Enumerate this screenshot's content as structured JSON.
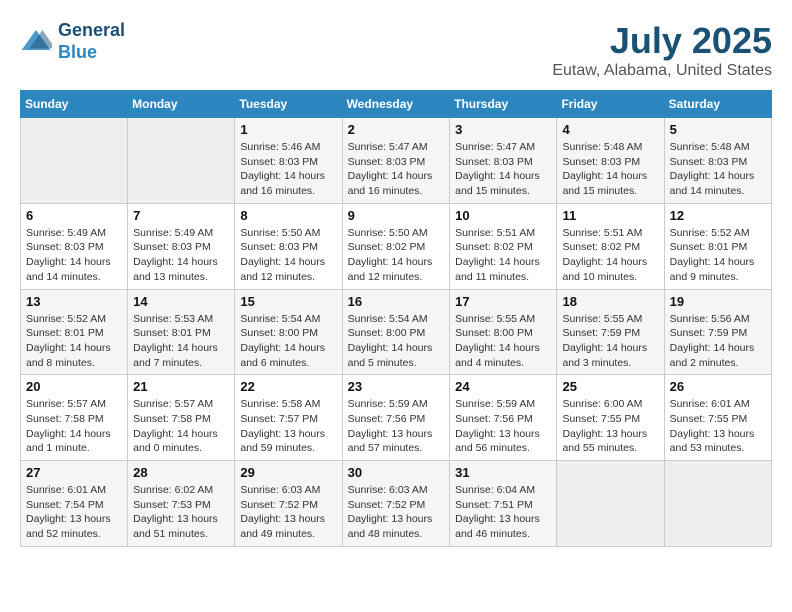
{
  "logo": {
    "line1": "General",
    "line2": "Blue"
  },
  "title": "July 2025",
  "subtitle": "Eutaw, Alabama, United States",
  "days_of_week": [
    "Sunday",
    "Monday",
    "Tuesday",
    "Wednesday",
    "Thursday",
    "Friday",
    "Saturday"
  ],
  "weeks": [
    [
      {
        "day": "",
        "empty": true
      },
      {
        "day": "",
        "empty": true
      },
      {
        "day": "1",
        "sunrise": "Sunrise: 5:46 AM",
        "sunset": "Sunset: 8:03 PM",
        "daylight": "Daylight: 14 hours and 16 minutes."
      },
      {
        "day": "2",
        "sunrise": "Sunrise: 5:47 AM",
        "sunset": "Sunset: 8:03 PM",
        "daylight": "Daylight: 14 hours and 16 minutes."
      },
      {
        "day": "3",
        "sunrise": "Sunrise: 5:47 AM",
        "sunset": "Sunset: 8:03 PM",
        "daylight": "Daylight: 14 hours and 15 minutes."
      },
      {
        "day": "4",
        "sunrise": "Sunrise: 5:48 AM",
        "sunset": "Sunset: 8:03 PM",
        "daylight": "Daylight: 14 hours and 15 minutes."
      },
      {
        "day": "5",
        "sunrise": "Sunrise: 5:48 AM",
        "sunset": "Sunset: 8:03 PM",
        "daylight": "Daylight: 14 hours and 14 minutes."
      }
    ],
    [
      {
        "day": "6",
        "sunrise": "Sunrise: 5:49 AM",
        "sunset": "Sunset: 8:03 PM",
        "daylight": "Daylight: 14 hours and 14 minutes."
      },
      {
        "day": "7",
        "sunrise": "Sunrise: 5:49 AM",
        "sunset": "Sunset: 8:03 PM",
        "daylight": "Daylight: 14 hours and 13 minutes."
      },
      {
        "day": "8",
        "sunrise": "Sunrise: 5:50 AM",
        "sunset": "Sunset: 8:03 PM",
        "daylight": "Daylight: 14 hours and 12 minutes."
      },
      {
        "day": "9",
        "sunrise": "Sunrise: 5:50 AM",
        "sunset": "Sunset: 8:02 PM",
        "daylight": "Daylight: 14 hours and 12 minutes."
      },
      {
        "day": "10",
        "sunrise": "Sunrise: 5:51 AM",
        "sunset": "Sunset: 8:02 PM",
        "daylight": "Daylight: 14 hours and 11 minutes."
      },
      {
        "day": "11",
        "sunrise": "Sunrise: 5:51 AM",
        "sunset": "Sunset: 8:02 PM",
        "daylight": "Daylight: 14 hours and 10 minutes."
      },
      {
        "day": "12",
        "sunrise": "Sunrise: 5:52 AM",
        "sunset": "Sunset: 8:01 PM",
        "daylight": "Daylight: 14 hours and 9 minutes."
      }
    ],
    [
      {
        "day": "13",
        "sunrise": "Sunrise: 5:52 AM",
        "sunset": "Sunset: 8:01 PM",
        "daylight": "Daylight: 14 hours and 8 minutes."
      },
      {
        "day": "14",
        "sunrise": "Sunrise: 5:53 AM",
        "sunset": "Sunset: 8:01 PM",
        "daylight": "Daylight: 14 hours and 7 minutes."
      },
      {
        "day": "15",
        "sunrise": "Sunrise: 5:54 AM",
        "sunset": "Sunset: 8:00 PM",
        "daylight": "Daylight: 14 hours and 6 minutes."
      },
      {
        "day": "16",
        "sunrise": "Sunrise: 5:54 AM",
        "sunset": "Sunset: 8:00 PM",
        "daylight": "Daylight: 14 hours and 5 minutes."
      },
      {
        "day": "17",
        "sunrise": "Sunrise: 5:55 AM",
        "sunset": "Sunset: 8:00 PM",
        "daylight": "Daylight: 14 hours and 4 minutes."
      },
      {
        "day": "18",
        "sunrise": "Sunrise: 5:55 AM",
        "sunset": "Sunset: 7:59 PM",
        "daylight": "Daylight: 14 hours and 3 minutes."
      },
      {
        "day": "19",
        "sunrise": "Sunrise: 5:56 AM",
        "sunset": "Sunset: 7:59 PM",
        "daylight": "Daylight: 14 hours and 2 minutes."
      }
    ],
    [
      {
        "day": "20",
        "sunrise": "Sunrise: 5:57 AM",
        "sunset": "Sunset: 7:58 PM",
        "daylight": "Daylight: 14 hours and 1 minute."
      },
      {
        "day": "21",
        "sunrise": "Sunrise: 5:57 AM",
        "sunset": "Sunset: 7:58 PM",
        "daylight": "Daylight: 14 hours and 0 minutes."
      },
      {
        "day": "22",
        "sunrise": "Sunrise: 5:58 AM",
        "sunset": "Sunset: 7:57 PM",
        "daylight": "Daylight: 13 hours and 59 minutes."
      },
      {
        "day": "23",
        "sunrise": "Sunrise: 5:59 AM",
        "sunset": "Sunset: 7:56 PM",
        "daylight": "Daylight: 13 hours and 57 minutes."
      },
      {
        "day": "24",
        "sunrise": "Sunrise: 5:59 AM",
        "sunset": "Sunset: 7:56 PM",
        "daylight": "Daylight: 13 hours and 56 minutes."
      },
      {
        "day": "25",
        "sunrise": "Sunrise: 6:00 AM",
        "sunset": "Sunset: 7:55 PM",
        "daylight": "Daylight: 13 hours and 55 minutes."
      },
      {
        "day": "26",
        "sunrise": "Sunrise: 6:01 AM",
        "sunset": "Sunset: 7:55 PM",
        "daylight": "Daylight: 13 hours and 53 minutes."
      }
    ],
    [
      {
        "day": "27",
        "sunrise": "Sunrise: 6:01 AM",
        "sunset": "Sunset: 7:54 PM",
        "daylight": "Daylight: 13 hours and 52 minutes."
      },
      {
        "day": "28",
        "sunrise": "Sunrise: 6:02 AM",
        "sunset": "Sunset: 7:53 PM",
        "daylight": "Daylight: 13 hours and 51 minutes."
      },
      {
        "day": "29",
        "sunrise": "Sunrise: 6:03 AM",
        "sunset": "Sunset: 7:52 PM",
        "daylight": "Daylight: 13 hours and 49 minutes."
      },
      {
        "day": "30",
        "sunrise": "Sunrise: 6:03 AM",
        "sunset": "Sunset: 7:52 PM",
        "daylight": "Daylight: 13 hours and 48 minutes."
      },
      {
        "day": "31",
        "sunrise": "Sunrise: 6:04 AM",
        "sunset": "Sunset: 7:51 PM",
        "daylight": "Daylight: 13 hours and 46 minutes."
      },
      {
        "day": "",
        "empty": true
      },
      {
        "day": "",
        "empty": true
      }
    ]
  ]
}
